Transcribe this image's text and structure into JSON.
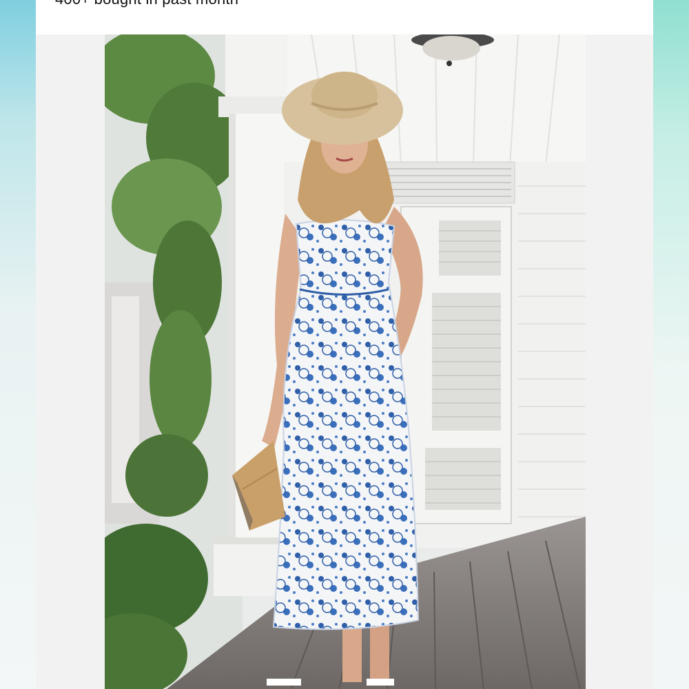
{
  "listing": {
    "bought_text": "400+ bought in past month"
  },
  "product_image": {
    "alt": "",
    "colors": {
      "dress_print": "#2f5fa8",
      "dress_base": "#f3f4f6",
      "hat": "#d8c3a0",
      "porch_white": "#f4f4f2",
      "deck_wood": "#8f8a86",
      "foliage": "#4f7a3a"
    }
  }
}
